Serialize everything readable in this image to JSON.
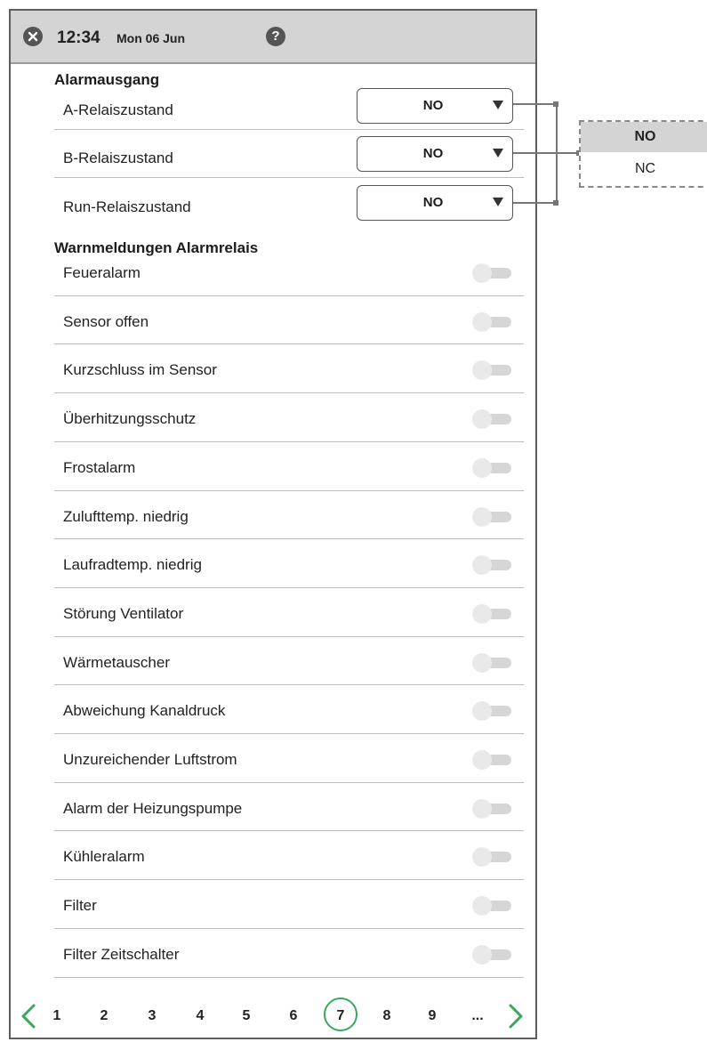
{
  "header": {
    "time": "12:34",
    "date": "Mon 06 Jun",
    "help_icon": "?"
  },
  "sections": {
    "alarm_output": "Alarmausgang",
    "warnings": "Warnmeldungen Alarmrelais"
  },
  "relays": [
    {
      "label": "A-Relaiszustand",
      "value": "NO"
    },
    {
      "label": "B-Relaiszustand",
      "value": "NO"
    },
    {
      "label": "Run-Relaiszustand",
      "value": "NO"
    }
  ],
  "warnings": [
    {
      "label": "Feueralarm",
      "on": false
    },
    {
      "label": "Sensor offen",
      "on": false
    },
    {
      "label": "Kurzschluss im Sensor",
      "on": false
    },
    {
      "label": "Überhitzungsschutz",
      "on": false
    },
    {
      "label": "Frostalarm",
      "on": false
    },
    {
      "label": "Zulufttemp. niedrig",
      "on": false
    },
    {
      "label": "Laufradtemp. niedrig",
      "on": false
    },
    {
      "label": "Störung Ventilator",
      "on": false
    },
    {
      "label": "Wärmetauscher",
      "on": false
    },
    {
      "label": "Abweichung Kanaldruck",
      "on": false
    },
    {
      "label": "Unzureichender Luftstrom",
      "on": false
    },
    {
      "label": "Alarm der Heizungspumpe",
      "on": false
    },
    {
      "label": "Kühleralarm",
      "on": false
    },
    {
      "label": "Filter",
      "on": false
    },
    {
      "label": "Filter Zeitschalter",
      "on": false
    }
  ],
  "pager": {
    "pages": [
      "1",
      "2",
      "3",
      "4",
      "5",
      "6",
      "7",
      "8",
      "9",
      "..."
    ],
    "current": "7"
  },
  "dropdown_options": {
    "selected": "NO",
    "other": "NC"
  },
  "colors": {
    "accent_green": "#3aa85a",
    "header_bg": "#d4d4d4"
  }
}
